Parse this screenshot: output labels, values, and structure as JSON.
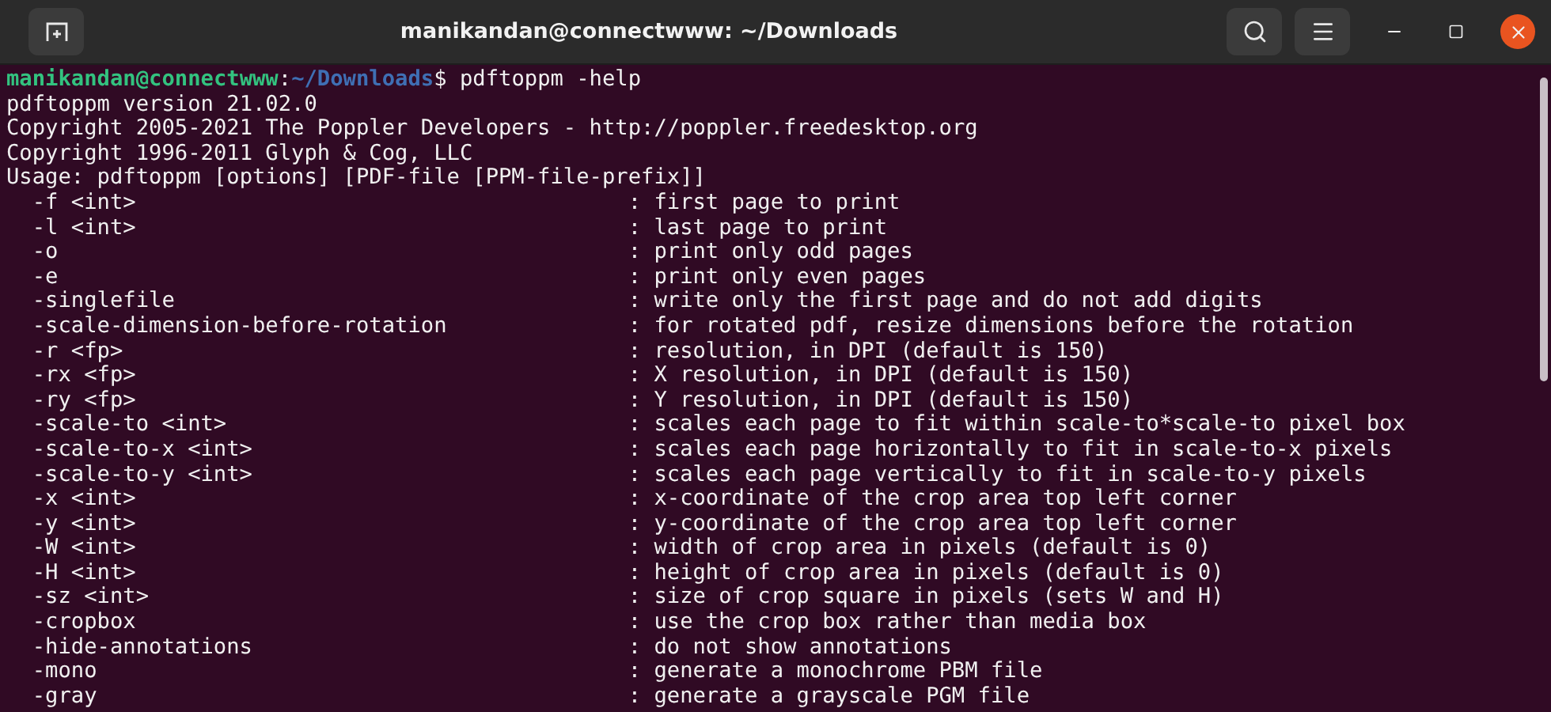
{
  "window": {
    "title": "manikandan@connectwww: ~/Downloads"
  },
  "prompt": {
    "user_host": "manikandan@connectwww",
    "separator": ":",
    "path": "~/Downloads",
    "symbol": "$",
    "command": " pdftoppm -help"
  },
  "output_lines": [
    "pdftoppm version 21.02.0",
    "Copyright 2005-2021 The Poppler Developers - http://poppler.freedesktop.org",
    "Copyright 1996-2011 Glyph & Cog, LLC",
    "Usage: pdftoppm [options] [PDF-file [PPM-file-prefix]]"
  ],
  "options": [
    {
      "option": "-f <int>",
      "description": ": first page to print"
    },
    {
      "option": "-l <int>",
      "description": ": last page to print"
    },
    {
      "option": "-o",
      "description": ": print only odd pages"
    },
    {
      "option": "-e",
      "description": ": print only even pages"
    },
    {
      "option": "-singlefile",
      "description": ": write only the first page and do not add digits"
    },
    {
      "option": "-scale-dimension-before-rotation",
      "description": ": for rotated pdf, resize dimensions before the rotation"
    },
    {
      "option": "-r <fp>",
      "description": ": resolution, in DPI (default is 150)"
    },
    {
      "option": "-rx <fp>",
      "description": ": X resolution, in DPI (default is 150)"
    },
    {
      "option": "-ry <fp>",
      "description": ": Y resolution, in DPI (default is 150)"
    },
    {
      "option": "-scale-to <int>",
      "description": ": scales each page to fit within scale-to*scale-to pixel box"
    },
    {
      "option": "-scale-to-x <int>",
      "description": ": scales each page horizontally to fit in scale-to-x pixels"
    },
    {
      "option": "-scale-to-y <int>",
      "description": ": scales each page vertically to fit in scale-to-y pixels"
    },
    {
      "option": "-x <int>",
      "description": ": x-coordinate of the crop area top left corner"
    },
    {
      "option": "-y <int>",
      "description": ": y-coordinate of the crop area top left corner"
    },
    {
      "option": "-W <int>",
      "description": ": width of crop area in pixels (default is 0)"
    },
    {
      "option": "-H <int>",
      "description": ": height of crop area in pixels (default is 0)"
    },
    {
      "option": "-sz <int>",
      "description": ": size of crop square in pixels (sets W and H)"
    },
    {
      "option": "-cropbox",
      "description": ": use the crop box rather than media box"
    },
    {
      "option": "-hide-annotations",
      "description": ": do not show annotations"
    },
    {
      "option": "-mono",
      "description": ": generate a monochrome PBM file"
    },
    {
      "option": "-gray",
      "description": ": generate a grayscale PGM file"
    }
  ]
}
